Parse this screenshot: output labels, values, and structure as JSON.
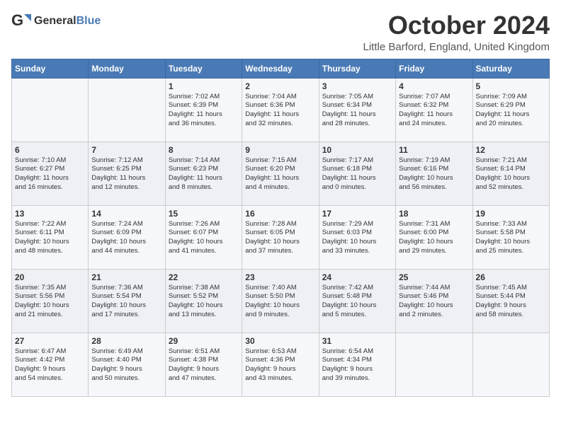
{
  "logo": {
    "general": "General",
    "blue": "Blue"
  },
  "header": {
    "month": "October 2024",
    "location": "Little Barford, England, United Kingdom"
  },
  "weekdays": [
    "Sunday",
    "Monday",
    "Tuesday",
    "Wednesday",
    "Thursday",
    "Friday",
    "Saturday"
  ],
  "weeks": [
    [
      {
        "day": "",
        "info": ""
      },
      {
        "day": "",
        "info": ""
      },
      {
        "day": "1",
        "info": "Sunrise: 7:02 AM\nSunset: 6:39 PM\nDaylight: 11 hours\nand 36 minutes."
      },
      {
        "day": "2",
        "info": "Sunrise: 7:04 AM\nSunset: 6:36 PM\nDaylight: 11 hours\nand 32 minutes."
      },
      {
        "day": "3",
        "info": "Sunrise: 7:05 AM\nSunset: 6:34 PM\nDaylight: 11 hours\nand 28 minutes."
      },
      {
        "day": "4",
        "info": "Sunrise: 7:07 AM\nSunset: 6:32 PM\nDaylight: 11 hours\nand 24 minutes."
      },
      {
        "day": "5",
        "info": "Sunrise: 7:09 AM\nSunset: 6:29 PM\nDaylight: 11 hours\nand 20 minutes."
      }
    ],
    [
      {
        "day": "6",
        "info": "Sunrise: 7:10 AM\nSunset: 6:27 PM\nDaylight: 11 hours\nand 16 minutes."
      },
      {
        "day": "7",
        "info": "Sunrise: 7:12 AM\nSunset: 6:25 PM\nDaylight: 11 hours\nand 12 minutes."
      },
      {
        "day": "8",
        "info": "Sunrise: 7:14 AM\nSunset: 6:23 PM\nDaylight: 11 hours\nand 8 minutes."
      },
      {
        "day": "9",
        "info": "Sunrise: 7:15 AM\nSunset: 6:20 PM\nDaylight: 11 hours\nand 4 minutes."
      },
      {
        "day": "10",
        "info": "Sunrise: 7:17 AM\nSunset: 6:18 PM\nDaylight: 11 hours\nand 0 minutes."
      },
      {
        "day": "11",
        "info": "Sunrise: 7:19 AM\nSunset: 6:16 PM\nDaylight: 10 hours\nand 56 minutes."
      },
      {
        "day": "12",
        "info": "Sunrise: 7:21 AM\nSunset: 6:14 PM\nDaylight: 10 hours\nand 52 minutes."
      }
    ],
    [
      {
        "day": "13",
        "info": "Sunrise: 7:22 AM\nSunset: 6:11 PM\nDaylight: 10 hours\nand 48 minutes."
      },
      {
        "day": "14",
        "info": "Sunrise: 7:24 AM\nSunset: 6:09 PM\nDaylight: 10 hours\nand 44 minutes."
      },
      {
        "day": "15",
        "info": "Sunrise: 7:26 AM\nSunset: 6:07 PM\nDaylight: 10 hours\nand 41 minutes."
      },
      {
        "day": "16",
        "info": "Sunrise: 7:28 AM\nSunset: 6:05 PM\nDaylight: 10 hours\nand 37 minutes."
      },
      {
        "day": "17",
        "info": "Sunrise: 7:29 AM\nSunset: 6:03 PM\nDaylight: 10 hours\nand 33 minutes."
      },
      {
        "day": "18",
        "info": "Sunrise: 7:31 AM\nSunset: 6:00 PM\nDaylight: 10 hours\nand 29 minutes."
      },
      {
        "day": "19",
        "info": "Sunrise: 7:33 AM\nSunset: 5:58 PM\nDaylight: 10 hours\nand 25 minutes."
      }
    ],
    [
      {
        "day": "20",
        "info": "Sunrise: 7:35 AM\nSunset: 5:56 PM\nDaylight: 10 hours\nand 21 minutes."
      },
      {
        "day": "21",
        "info": "Sunrise: 7:36 AM\nSunset: 5:54 PM\nDaylight: 10 hours\nand 17 minutes."
      },
      {
        "day": "22",
        "info": "Sunrise: 7:38 AM\nSunset: 5:52 PM\nDaylight: 10 hours\nand 13 minutes."
      },
      {
        "day": "23",
        "info": "Sunrise: 7:40 AM\nSunset: 5:50 PM\nDaylight: 10 hours\nand 9 minutes."
      },
      {
        "day": "24",
        "info": "Sunrise: 7:42 AM\nSunset: 5:48 PM\nDaylight: 10 hours\nand 5 minutes."
      },
      {
        "day": "25",
        "info": "Sunrise: 7:44 AM\nSunset: 5:46 PM\nDaylight: 10 hours\nand 2 minutes."
      },
      {
        "day": "26",
        "info": "Sunrise: 7:45 AM\nSunset: 5:44 PM\nDaylight: 9 hours\nand 58 minutes."
      }
    ],
    [
      {
        "day": "27",
        "info": "Sunrise: 6:47 AM\nSunset: 4:42 PM\nDaylight: 9 hours\nand 54 minutes."
      },
      {
        "day": "28",
        "info": "Sunrise: 6:49 AM\nSunset: 4:40 PM\nDaylight: 9 hours\nand 50 minutes."
      },
      {
        "day": "29",
        "info": "Sunrise: 6:51 AM\nSunset: 4:38 PM\nDaylight: 9 hours\nand 47 minutes."
      },
      {
        "day": "30",
        "info": "Sunrise: 6:53 AM\nSunset: 4:36 PM\nDaylight: 9 hours\nand 43 minutes."
      },
      {
        "day": "31",
        "info": "Sunrise: 6:54 AM\nSunset: 4:34 PM\nDaylight: 9 hours\nand 39 minutes."
      },
      {
        "day": "",
        "info": ""
      },
      {
        "day": "",
        "info": ""
      }
    ]
  ]
}
